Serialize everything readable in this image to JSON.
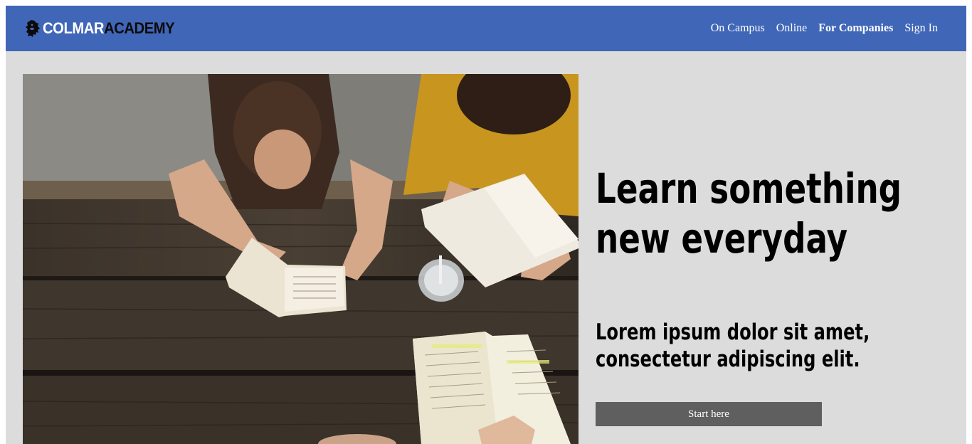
{
  "brand": {
    "logo_part1": "COLMAR",
    "logo_part2": "ACADEMY",
    "logo_icon": "lion-crest-icon"
  },
  "nav": {
    "items": [
      {
        "label": "On Campus",
        "bold": false
      },
      {
        "label": "Online",
        "bold": false
      },
      {
        "label": "For Companies",
        "bold": true
      },
      {
        "label": "Sign In",
        "bold": false
      }
    ]
  },
  "hero": {
    "image": "students-studying-at-wooden-table-photo",
    "headline": "Learn something new everyday",
    "subheadline": "Lorem ipsum dolor sit amet, consectetur adipiscing elit.",
    "cta_label": "Start here"
  },
  "colors": {
    "navbar": "#4066b8",
    "page_background": "#dcdcdc",
    "button": "#5f5f5f"
  }
}
